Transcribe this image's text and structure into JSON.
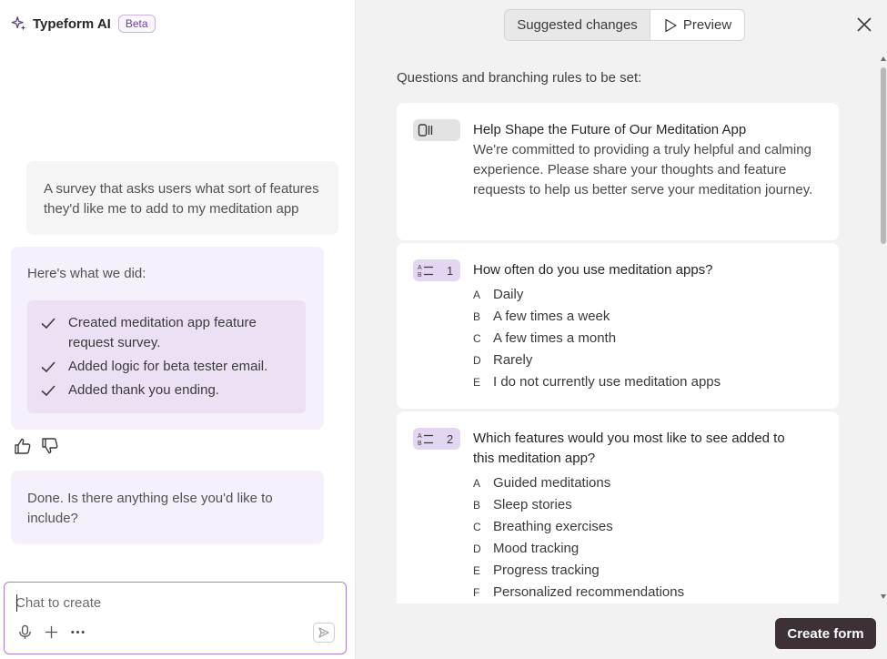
{
  "header": {
    "title": "Typeform AI",
    "badge": "Beta"
  },
  "conversation": {
    "user_message": "A survey that asks users what sort of features they'd like me to add to my meditation app",
    "ai_summary": {
      "heading": "Here's what we did:",
      "items": [
        "Created meditation app feature request survey.",
        "Added logic for beta tester email.",
        "Added thank you ending."
      ]
    },
    "followup": "Done. Is there anything else you'd like to include?"
  },
  "chat_input": {
    "placeholder": "Chat to create",
    "value": ""
  },
  "right_panel": {
    "tabs": [
      "Suggested changes",
      "Preview"
    ],
    "active_tab": "Suggested changes",
    "subtitle": "Questions and branching rules to be set:",
    "statement": {
      "title": "Help Shape the Future of Our Meditation App",
      "description": "We're committed to providing a truly helpful and calming experience. Please share your thoughts and feature requests to help us better serve your meditation journey."
    },
    "questions": [
      {
        "number": "1",
        "text": "How often do you use meditation apps?",
        "choices": [
          {
            "letter": "A",
            "label": "Daily"
          },
          {
            "letter": "B",
            "label": "A few times a week"
          },
          {
            "letter": "C",
            "label": "A few times a month"
          },
          {
            "letter": "D",
            "label": "Rarely"
          },
          {
            "letter": "E",
            "label": "I do not currently use meditation apps"
          }
        ]
      },
      {
        "number": "2",
        "text": "Which features would you most like to see added to this meditation app?",
        "choices": [
          {
            "letter": "A",
            "label": "Guided meditations"
          },
          {
            "letter": "B",
            "label": "Sleep stories"
          },
          {
            "letter": "C",
            "label": "Breathing exercises"
          },
          {
            "letter": "D",
            "label": "Mood tracking"
          },
          {
            "letter": "E",
            "label": "Progress tracking"
          },
          {
            "letter": "F",
            "label": "Personalized recommendations"
          }
        ]
      }
    ],
    "create_button": "Create form"
  },
  "colors": {
    "accent": "#a97ed6",
    "ai_bubble": "#f6effc",
    "primary_button": "#3d3036"
  }
}
